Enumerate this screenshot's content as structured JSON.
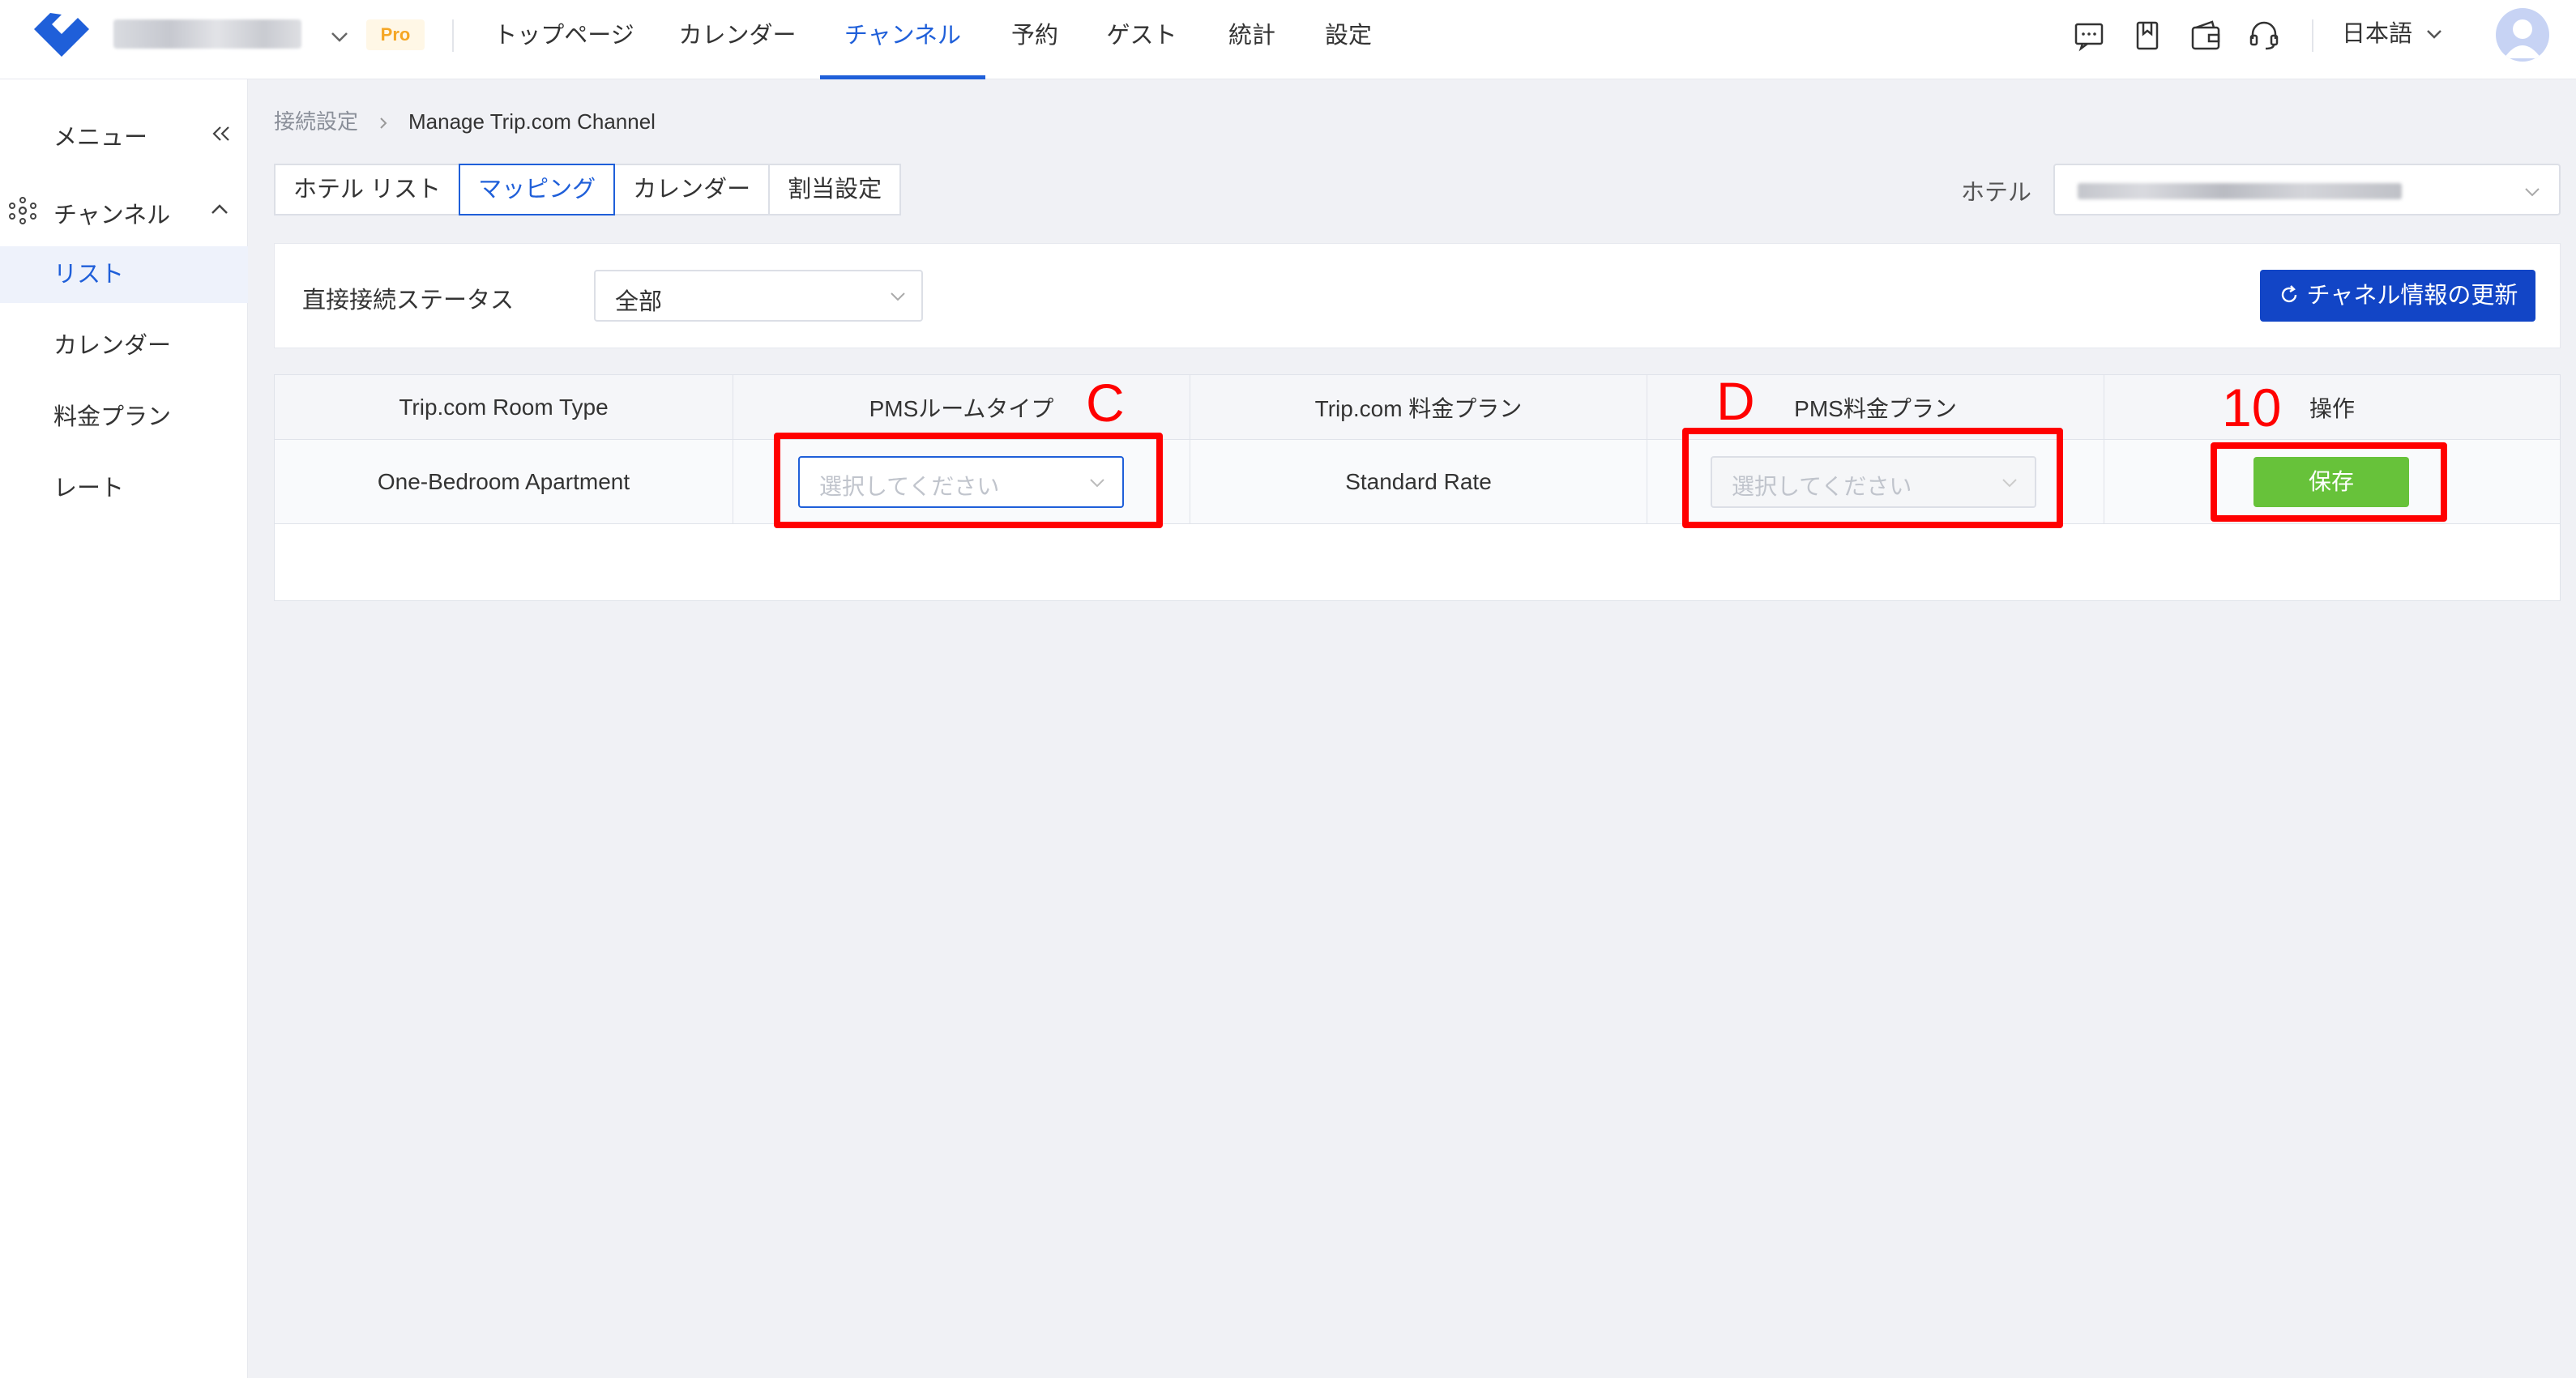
{
  "header": {
    "pro_badge": "Pro",
    "nav": [
      {
        "label": "トップページ"
      },
      {
        "label": "カレンダー"
      },
      {
        "label": "チャンネル"
      },
      {
        "label": "予約"
      },
      {
        "label": "ゲスト"
      },
      {
        "label": "統計"
      },
      {
        "label": "設定"
      }
    ],
    "active_nav": "チャンネル",
    "language": "日本語",
    "icons": [
      "message-icon",
      "bookmark-icon",
      "wallet-icon",
      "headset-icon"
    ]
  },
  "sidebar": {
    "title": "メニュー",
    "group": "チャンネル",
    "items": [
      {
        "label": "リスト"
      },
      {
        "label": "カレンダー"
      },
      {
        "label": "料金プラン"
      },
      {
        "label": "レート"
      }
    ],
    "active_item": "リスト"
  },
  "breadcrumb": {
    "parent": "接続設定",
    "current": "Manage Trip.com Channel"
  },
  "tabs": [
    {
      "label": "ホテル リスト"
    },
    {
      "label": "マッピング"
    },
    {
      "label": "カレンダー"
    },
    {
      "label": "割当設定"
    }
  ],
  "active_tab": "マッピング",
  "hotel": {
    "label": "ホテル"
  },
  "filter": {
    "label": "直接接続ステータス",
    "value": "全部",
    "refresh_label": "チャネル情報の更新"
  },
  "table": {
    "headers": [
      "Trip.com Room Type",
      "PMSルームタイプ",
      "Trip.com 料金プラン",
      "PMS料金プラン",
      "操作"
    ],
    "rows": [
      {
        "room_type": "One-Bedroom Apartment",
        "pms_room_placeholder": "選択してください",
        "rate_plan": "Standard Rate",
        "pms_rate_placeholder": "選択してください",
        "action": "保存"
      }
    ]
  },
  "annotations": {
    "c": "C",
    "d": "D",
    "ten": "10",
    "color": "#ff0000"
  },
  "colors": {
    "accent": "#1f5fd9",
    "refresh_button": "#1245c6",
    "save_button": "#67c23a"
  }
}
